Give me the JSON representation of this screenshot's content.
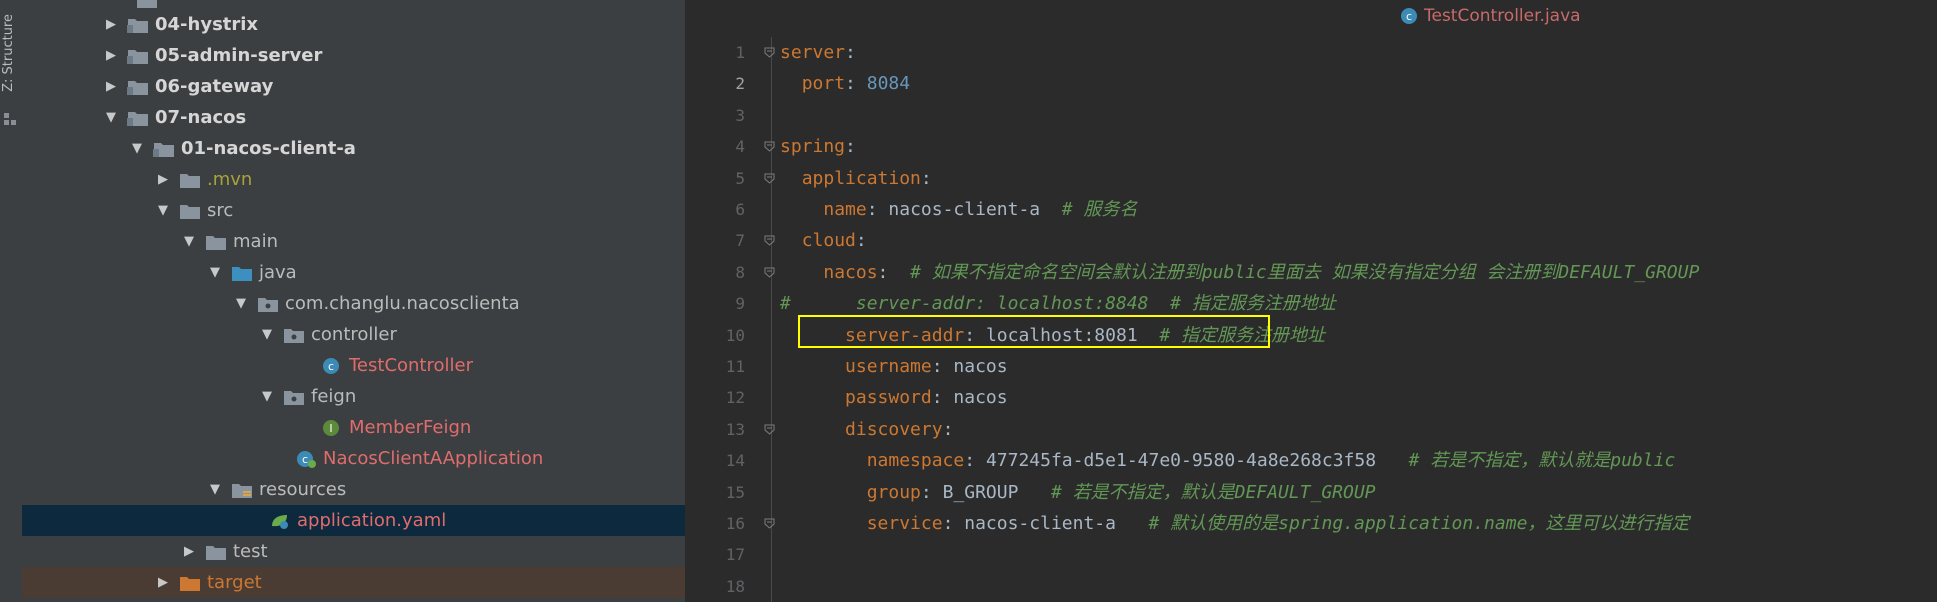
{
  "structure_panel": {
    "label": "Z: Structure"
  },
  "project_tree": {
    "rows": [
      {
        "name": "04-hystrix",
        "bold": true,
        "color": "bold"
      },
      {
        "name": "05-admin-server",
        "bold": true,
        "color": "bold"
      },
      {
        "name": "06-gateway",
        "bold": true,
        "color": "bold"
      },
      {
        "name": "07-nacos",
        "bold": true,
        "color": "bold"
      },
      {
        "name": "01-nacos-client-a",
        "bold": true,
        "color": "bold"
      },
      {
        "name": ".mvn",
        "color": "olive"
      },
      {
        "name": "src",
        "color": "plain"
      },
      {
        "name": "main",
        "color": "plain"
      },
      {
        "name": "java",
        "color": "plain"
      },
      {
        "name": "com.changlu.nacosclienta",
        "color": "plain"
      },
      {
        "name": "controller",
        "color": "plain"
      },
      {
        "name": "TestController",
        "color": "red"
      },
      {
        "name": "feign",
        "color": "plain"
      },
      {
        "name": "MemberFeign",
        "color": "red"
      },
      {
        "name": "NacosClientAApplication",
        "color": "red"
      },
      {
        "name": "resources",
        "color": "plain"
      },
      {
        "name": "application.yaml",
        "color": "red",
        "selected": true
      },
      {
        "name": "test",
        "color": "plain"
      },
      {
        "name": "target",
        "color": "orange"
      }
    ]
  },
  "editor": {
    "active_tab": "TestController.java",
    "current_line": 2,
    "line_numbers": [
      "1",
      "2",
      "3",
      "4",
      "5",
      "6",
      "7",
      "8",
      "9",
      "10",
      "11",
      "12",
      "13",
      "14",
      "15",
      "16",
      "17",
      "18"
    ],
    "lines": [
      {
        "indent": "",
        "key": "server",
        "sep": ":",
        "value": "",
        "comment": ""
      },
      {
        "indent": "  ",
        "key": "port",
        "sep": ": ",
        "value": "8084",
        "value_type": "num",
        "comment": ""
      },
      {
        "indent": "",
        "key": "",
        "sep": "",
        "value": "",
        "comment": ""
      },
      {
        "indent": "",
        "key": "spring",
        "sep": ":",
        "value": "",
        "comment": ""
      },
      {
        "indent": "  ",
        "key": "application",
        "sep": ":",
        "value": "",
        "comment": ""
      },
      {
        "indent": "    ",
        "key": "name",
        "sep": ": ",
        "value": "nacos-client-a",
        "comment": "  # 服务名"
      },
      {
        "indent": "  ",
        "key": "cloud",
        "sep": ":",
        "value": "",
        "comment": ""
      },
      {
        "indent": "    ",
        "key": "nacos",
        "sep": ":",
        "value": "",
        "comment": "  # 如果不指定命名空间会默认注册到public里面去 如果没有指定分组 会注册到DEFAULT_GROUP"
      },
      {
        "indent": "",
        "key": "",
        "sep": "",
        "value": "",
        "comment": "#      server-addr: localhost:8848  # 指定服务注册地址"
      },
      {
        "indent": "      ",
        "key": "server-addr",
        "sep": ": ",
        "value": "localhost:8081",
        "comment": "  # 指定服务注册地址"
      },
      {
        "indent": "      ",
        "key": "username",
        "sep": ": ",
        "value": "nacos",
        "comment": ""
      },
      {
        "indent": "      ",
        "key": "password",
        "sep": ": ",
        "value": "nacos",
        "comment": ""
      },
      {
        "indent": "      ",
        "key": "discovery",
        "sep": ":",
        "value": "",
        "comment": ""
      },
      {
        "indent": "        ",
        "key": "namespace",
        "sep": ": ",
        "value": "477245fa-d5e1-47e0-9580-4a8e268c3f58",
        "comment": "   # 若是不指定，默认就是public"
      },
      {
        "indent": "        ",
        "key": "group",
        "sep": ": ",
        "value": "B_GROUP",
        "comment": "   # 若是不指定，默认是DEFAULT_GROUP"
      },
      {
        "indent": "        ",
        "key": "service",
        "sep": ": ",
        "value": "nacos-client-a",
        "comment": "   # 默认使用的是spring.application.name，这里可以进行指定"
      },
      {
        "indent": "",
        "key": "",
        "sep": "",
        "value": "",
        "comment": ""
      },
      {
        "indent": "",
        "key": "",
        "sep": "",
        "value": "",
        "comment": ""
      }
    ]
  },
  "colors": {
    "background": "#2b2b2b",
    "panel": "#3c3f41",
    "selection": "#0d293e",
    "highlight_box": "#ffff00",
    "yaml_key": "#cc7832",
    "number": "#6897bb",
    "comment": "#629755"
  }
}
